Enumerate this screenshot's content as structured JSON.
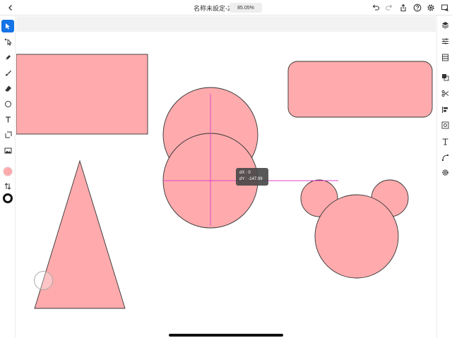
{
  "header": {
    "doc_title": "名称未設定-2",
    "zoom": "85.05%"
  },
  "left_toolbar": {
    "tools": [
      "select-icon",
      "direct-select-icon",
      "pen-icon",
      "brush-icon",
      "eraser-icon",
      "ellipse-icon",
      "text-icon",
      "shape-icon",
      "image-icon"
    ],
    "fill_color": "#ffabad",
    "stroke_color": "#111111"
  },
  "right_toolbar": {
    "tools": [
      "layers-icon",
      "properties-icon",
      "libraries-icon",
      "arrange-icon",
      "scissors-icon",
      "align-icon",
      "transform-icon",
      "type-icon",
      "path-icon",
      "settings-icon"
    ]
  },
  "canvas": {
    "shape_fill": "#ffabad",
    "shape_stroke": "#333333",
    "guide_color": "#e040c8"
  },
  "move_tooltip": {
    "dx": "dX : 0",
    "dy": "dY : -147.99"
  }
}
